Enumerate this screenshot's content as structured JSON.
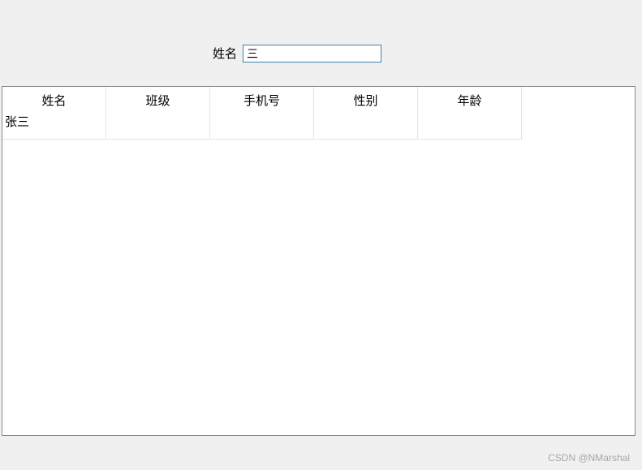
{
  "search": {
    "label": "姓名",
    "value": "三"
  },
  "table": {
    "columns": [
      "姓名",
      "班级",
      "手机号",
      "性别",
      "年龄"
    ],
    "rows": [
      [
        "张三",
        "",
        "",
        "",
        ""
      ]
    ]
  },
  "watermark": "CSDN @NMarshal"
}
